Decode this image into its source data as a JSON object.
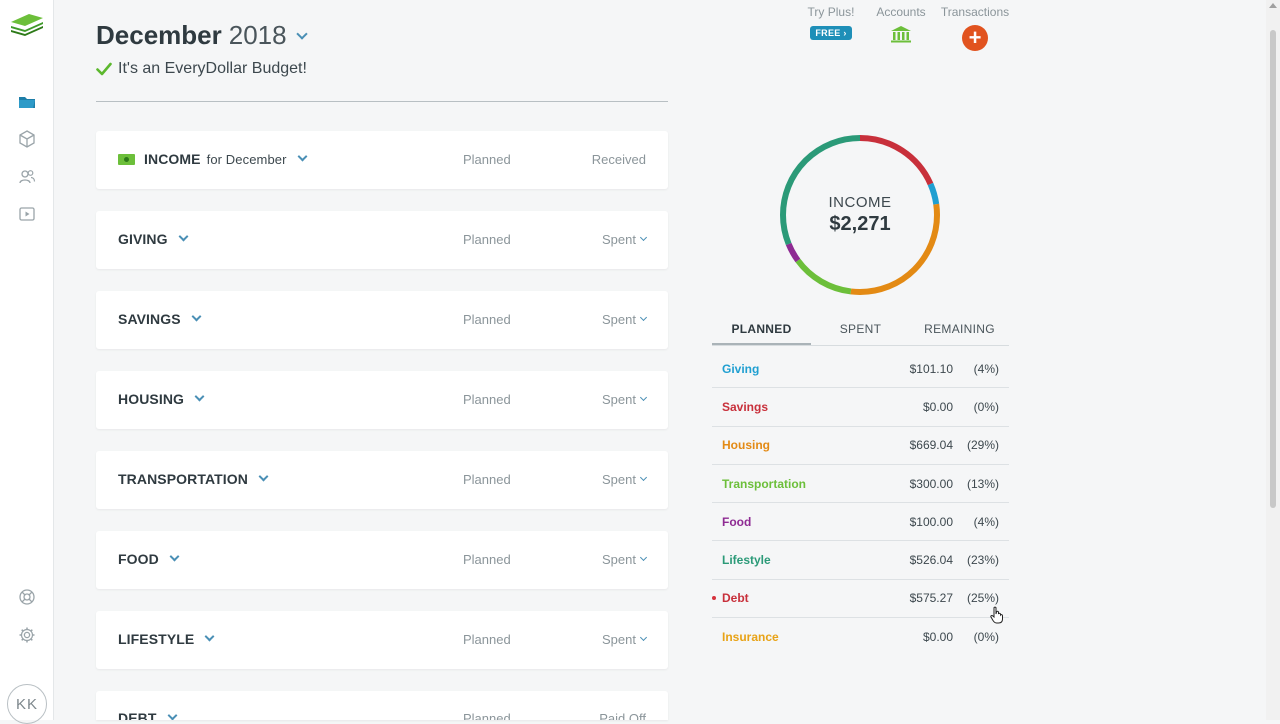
{
  "header": {
    "month": "December",
    "year": "2018",
    "subtitle": "It's an EveryDollar Budget!"
  },
  "top_actions": {
    "try_plus": "Try Plus!",
    "free_badge": "FREE",
    "accounts": "Accounts",
    "transactions": "Transactions"
  },
  "user": {
    "initials": "KK"
  },
  "budget_groups": [
    {
      "name": "INCOME",
      "suffix": "for December",
      "planned": "Planned",
      "right": "Received"
    },
    {
      "name": "GIVING",
      "planned": "Planned",
      "right": "Spent"
    },
    {
      "name": "SAVINGS",
      "planned": "Planned",
      "right": "Spent"
    },
    {
      "name": "HOUSING",
      "planned": "Planned",
      "right": "Spent"
    },
    {
      "name": "TRANSPORTATION",
      "planned": "Planned",
      "right": "Spent"
    },
    {
      "name": "FOOD",
      "planned": "Planned",
      "right": "Spent"
    },
    {
      "name": "LIFESTYLE",
      "planned": "Planned",
      "right": "Spent"
    },
    {
      "name": "DEBT",
      "planned": "Planned",
      "right": "Paid Off"
    }
  ],
  "summary": {
    "donut_label": "INCOME",
    "donut_amount": "$2,271",
    "tabs": [
      "PLANNED",
      "SPENT",
      "REMAINING"
    ],
    "active_tab": "PLANNED",
    "rows": [
      {
        "category": "Giving",
        "amount": "$101.10",
        "percent": "(4%)",
        "color": "#1f9fd1"
      },
      {
        "category": "Savings",
        "amount": "$0.00",
        "percent": "(0%)",
        "color": "#c8303b"
      },
      {
        "category": "Housing",
        "amount": "$669.04",
        "percent": "(29%)",
        "color": "#e38a14"
      },
      {
        "category": "Transportation",
        "amount": "$300.00",
        "percent": "(13%)",
        "color": "#6cbf3a"
      },
      {
        "category": "Food",
        "amount": "$100.00",
        "percent": "(4%)",
        "color": "#8e2b93"
      },
      {
        "category": "Lifestyle",
        "amount": "$526.04",
        "percent": "(23%)",
        "color": "#2b9a78"
      },
      {
        "category": "Debt",
        "amount": "$575.27",
        "percent": "(25%)",
        "color": "#c8303b",
        "flag": true
      },
      {
        "category": "Insurance",
        "amount": "$0.00",
        "percent": "(0%)",
        "color": "#e8a317"
      }
    ]
  },
  "icons": {
    "logo": "everydollar-logo-icon",
    "budget": "folder-icon",
    "funds": "cube-icon",
    "contacts": "people-icon",
    "video": "video-icon",
    "help": "lifebuoy-icon",
    "settings": "gear-icon",
    "accounts": "bank-icon",
    "add": "plus-icon"
  }
}
